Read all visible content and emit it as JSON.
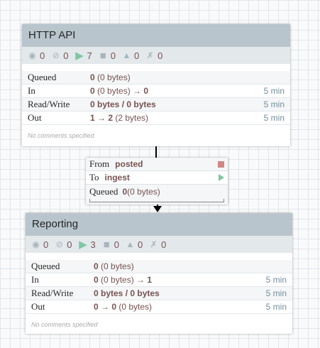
{
  "groups": [
    {
      "title": "HTTP API",
      "status": {
        "transmitting": "0",
        "not_transmitting": "0",
        "running": "7",
        "stopped": "0",
        "invalid": "0",
        "disabled": "0"
      },
      "rows": [
        {
          "label": "Queued",
          "b1": "0",
          "rest": " (0 bytes)",
          "time": ""
        },
        {
          "label": "In",
          "b1": "0",
          "rest": " (0 bytes) → ",
          "b2": "0",
          "time": "5 min"
        },
        {
          "label": "Read/Write",
          "b1": "0 bytes / 0 bytes",
          "rest": "",
          "time": "5 min"
        },
        {
          "label": "Out",
          "b1": "1 → 2",
          "rest": " (2 bytes)",
          "time": "5 min"
        }
      ],
      "comments": "No comments specified"
    },
    {
      "title": "Reporting",
      "status": {
        "transmitting": "0",
        "not_transmitting": "0",
        "running": "3",
        "stopped": "0",
        "invalid": "0",
        "disabled": "0"
      },
      "rows": [
        {
          "label": "Queued",
          "b1": "0",
          "rest": " (0 bytes)",
          "time": ""
        },
        {
          "label": "In",
          "b1": "0",
          "rest": " (0 bytes) → ",
          "b2": "1",
          "time": "5 min"
        },
        {
          "label": "Read/Write",
          "b1": "0 bytes / 0 bytes",
          "rest": "",
          "time": "5 min"
        },
        {
          "label": "Out",
          "b1": "0 → 0",
          "rest": " (0 bytes)",
          "time": "5 min"
        }
      ],
      "comments": "No comments specified"
    }
  ],
  "connection": {
    "from_label": "From",
    "from": "posted",
    "to_label": "To",
    "to": "ingest",
    "queued_label": "Queued",
    "queued_count": "0",
    "queued_size": " (0 bytes)"
  },
  "colors": {
    "running": "#7dc7a0",
    "stopped": "#d18686",
    "header": "#b8c5cc"
  }
}
